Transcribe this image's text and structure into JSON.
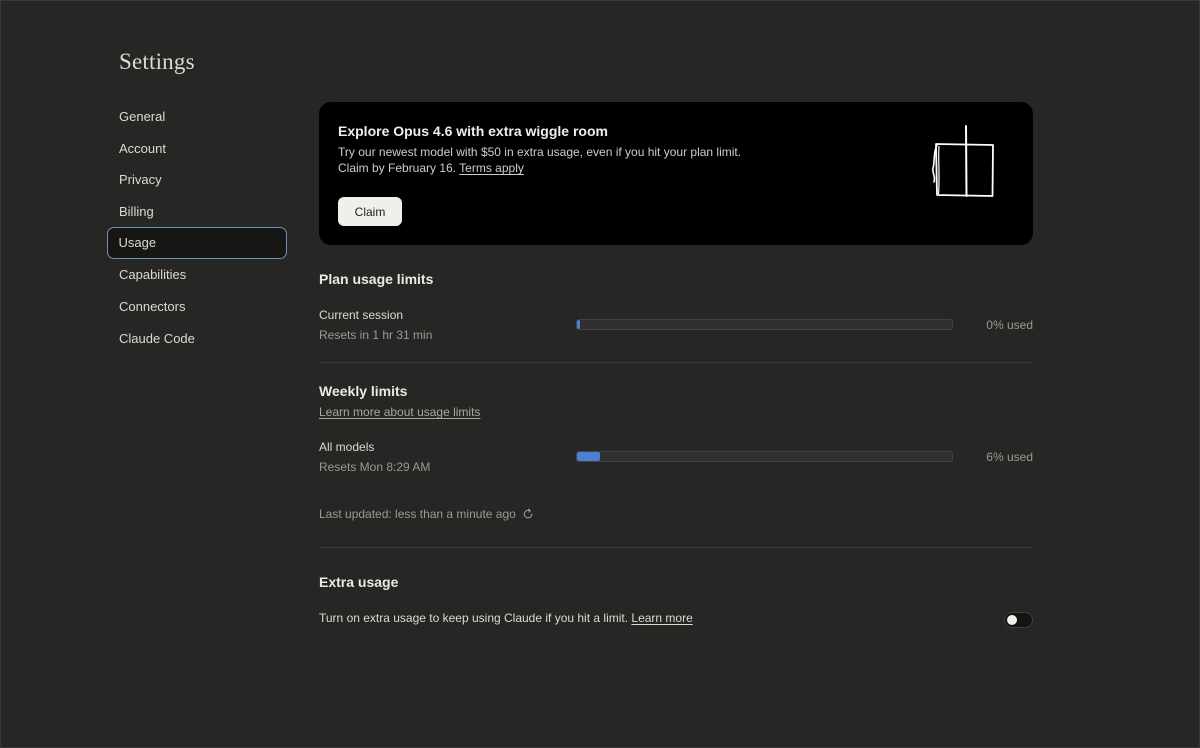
{
  "page_title": "Settings",
  "sidebar": {
    "items": [
      {
        "label": "General"
      },
      {
        "label": "Account"
      },
      {
        "label": "Privacy"
      },
      {
        "label": "Billing"
      },
      {
        "label": "Usage",
        "active": true
      },
      {
        "label": "Capabilities"
      },
      {
        "label": "Connectors"
      },
      {
        "label": "Claude Code"
      }
    ]
  },
  "promo": {
    "title": "Explore Opus 4.6 with extra wiggle room",
    "line1": "Try our newest model with $50 in extra usage, even if you hit your plan limit.",
    "line2": "Claim by February 16.",
    "terms_link": "Terms apply",
    "claim_label": "Claim",
    "art_icon": "door-sketch-icon"
  },
  "plan_usage": {
    "title": "Plan usage limits",
    "current_session": {
      "label": "Current session",
      "reset": "Resets in 1 hr 31 min",
      "percent": 0,
      "used_text": "0% used"
    }
  },
  "weekly": {
    "title": "Weekly limits",
    "learn_more": "Learn more about usage limits",
    "all_models": {
      "label": "All models",
      "reset": "Resets Mon 8:29 AM",
      "percent": 6,
      "used_text": "6% used"
    },
    "last_updated": "Last updated: less than a minute ago",
    "refresh_icon": "refresh-icon"
  },
  "extra_usage": {
    "title": "Extra usage",
    "text": "Turn on extra usage to keep using Claude if you hit a limit.",
    "learn_more": "Learn more",
    "enabled": false
  },
  "colors": {
    "background": "#262625",
    "accent_bar": "#4a7fd6",
    "active_outline": "#6f8fb8"
  }
}
